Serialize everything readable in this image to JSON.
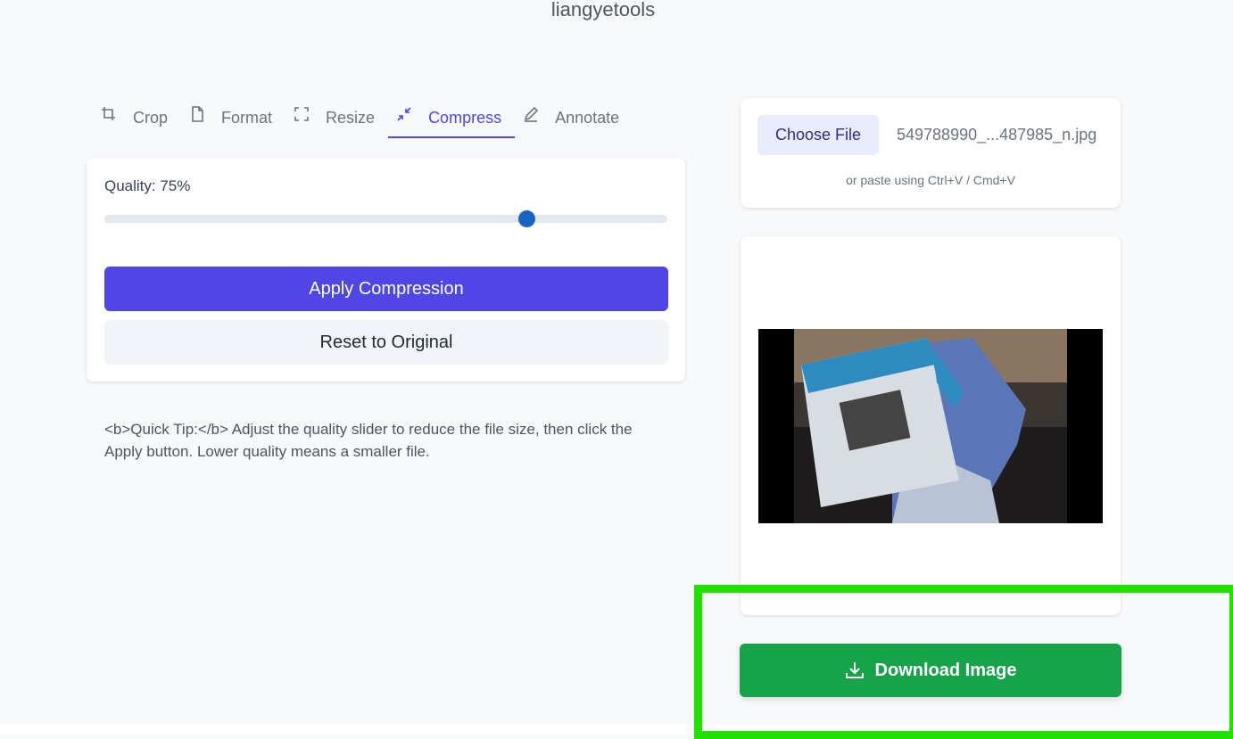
{
  "header": {
    "site_title": "liangyetools"
  },
  "tabs": [
    {
      "label": "Crop",
      "icon": "crop-icon",
      "active": false
    },
    {
      "label": "Format",
      "icon": "file-icon",
      "active": false
    },
    {
      "label": "Resize",
      "icon": "resize-icon",
      "active": false
    },
    {
      "label": "Compress",
      "icon": "compress-icon",
      "active": true
    },
    {
      "label": "Annotate",
      "icon": "pencil-icon",
      "active": false
    }
  ],
  "compress_panel": {
    "quality_label": "Quality: 75%",
    "quality_value": 75,
    "apply_label": "Apply Compression",
    "reset_label": "Reset to Original"
  },
  "tip": {
    "text": "<b>Quick Tip:</b> Adjust the quality slider to reduce the file size, then click the Apply button. Lower quality means a smaller file."
  },
  "upload": {
    "choose_label": "Choose File",
    "file_name": "549788990_...487985_n.jpg",
    "paste_hint": "or paste using Ctrl+V / Cmd+V"
  },
  "download": {
    "label": "Download Image",
    "icon": "download-icon"
  },
  "colors": {
    "accent": "#4f46e5",
    "download": "#16a34a",
    "slider_thumb": "#1565c0",
    "highlight": "#22e000"
  }
}
